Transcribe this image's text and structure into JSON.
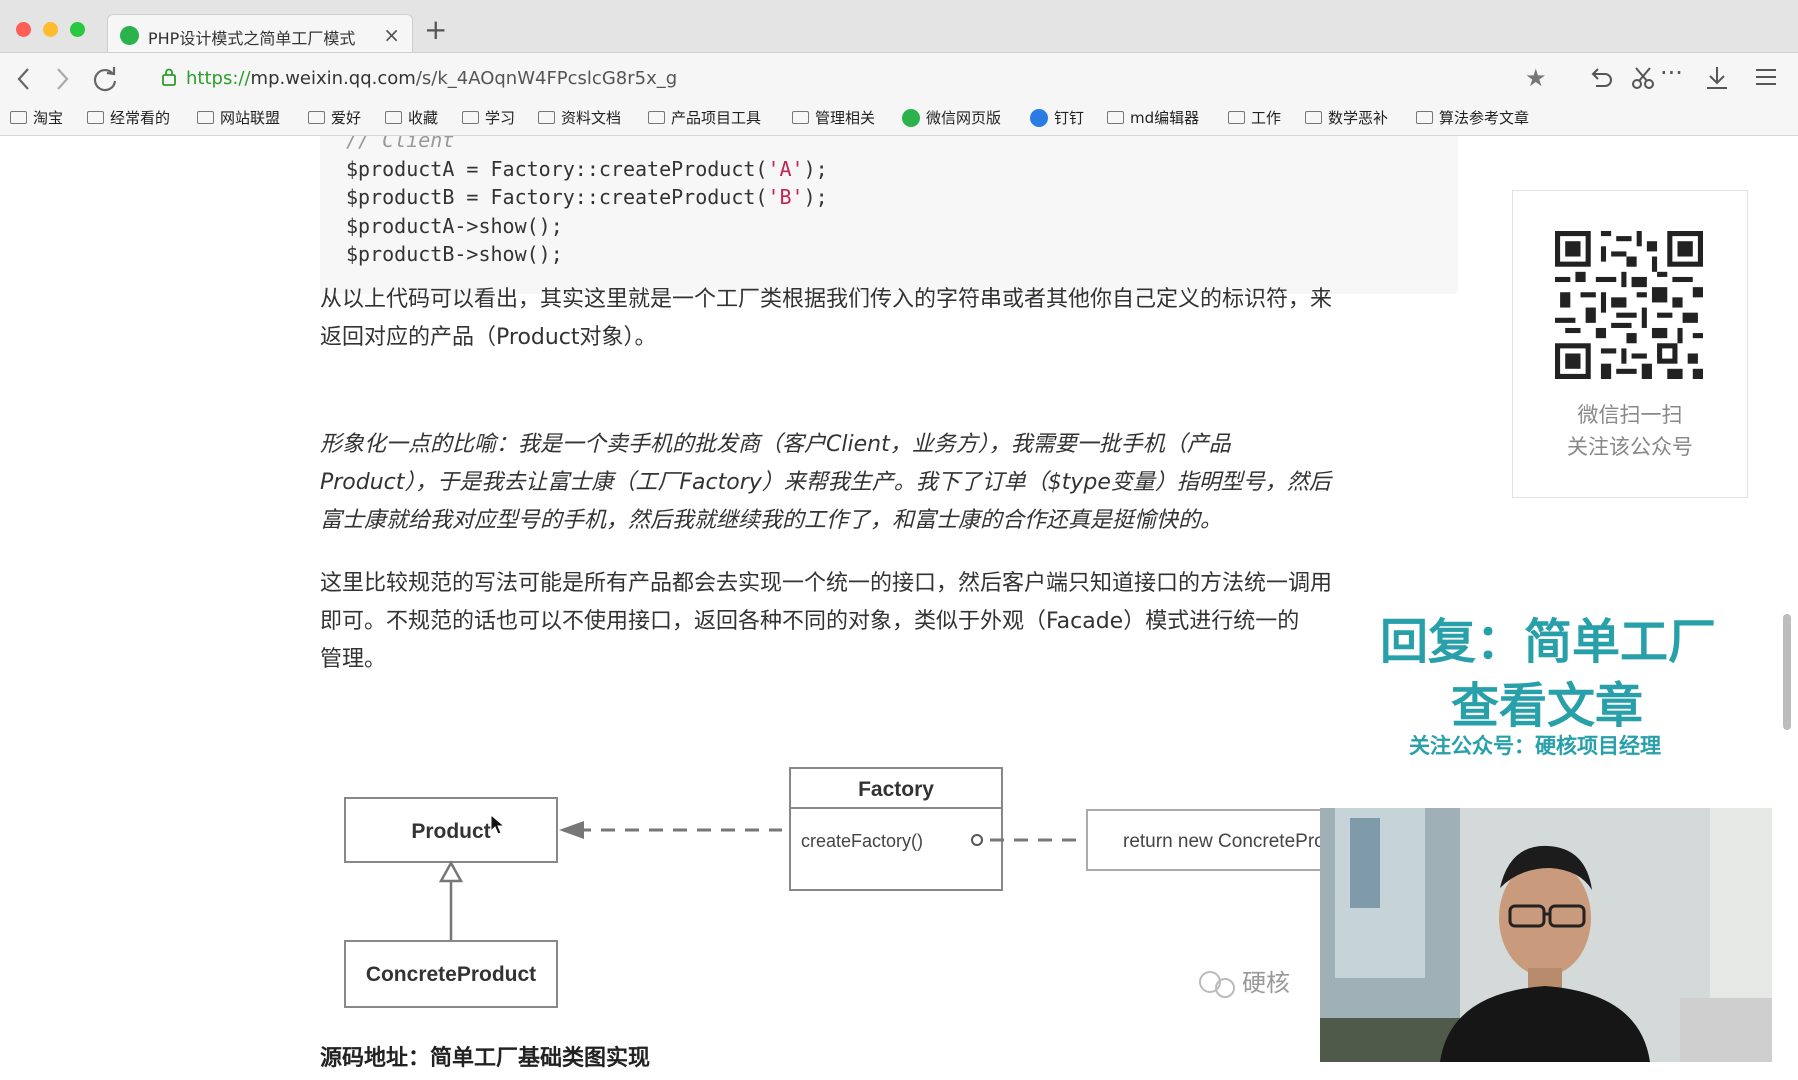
{
  "tab": {
    "title": "PHP设计模式之简单工厂模式",
    "close": "×",
    "new_tab": "+"
  },
  "address": {
    "scheme": "https://",
    "host": "mp.weixin.qq.com",
    "path": "/s/k_4AOqnW4FPcslcG8r5x_g"
  },
  "bookmarks": [
    "淘宝",
    "经常看的",
    "网站联盟",
    "爱好",
    "收藏",
    "学习",
    "资料文档",
    "产品项目工具",
    "管理相关",
    "微信网页版",
    "钉钉",
    "md编辑器",
    "工作",
    "数学恶补",
    "算法参考文章"
  ],
  "code": {
    "comment": "// Client",
    "line1_a": "$productA = Factory::createProduct(",
    "line1_str": "'A'",
    "line1_b": ");",
    "line2_a": "$productB = Factory::createProduct(",
    "line2_str": "'B'",
    "line2_b": ");",
    "line3": "$productA->show();",
    "line4": "$productB->show();"
  },
  "article": {
    "p1_line1": "从以上代码可以看出，其实这里就是一个工厂类根据我们传入的字符串或者其他你自己定义的标识符，来",
    "p1_line2": "返回对应的产品（Product对象）。",
    "p2_line1": "形象化一点的比喻：我是一个卖手机的批发商（客户Client，业务方），我需要一批手机（产品",
    "p2_line2": "Product），于是我去让富士康（工厂Factory）来帮我生产。我下了订单（$type变量）指明型号，然后",
    "p2_line3": "富士康就给我对应型号的手机，然后我就继续我的工作了，和富士康的合作还真是挺愉快的。",
    "p3_line1": "这里比较规范的写法可能是所有产品都会去实现一个统一的接口，然后客户端只知道接口的方法统一调用",
    "p3_line2": "即可。不规范的话也可以不使用接口，返回各种不同的对象，类似于外观（Facade）模式进行统一的",
    "p3_line3": "管理。",
    "source": "源码地址：简单工厂基础类图实现"
  },
  "diagram": {
    "product": "Product",
    "factory": "Factory",
    "factory_method": "createFactory()",
    "note": "return new ConcreteProduct",
    "concrete": "ConcreteProduct",
    "watermark": "硬核"
  },
  "qr": {
    "line1": "微信扫一扫",
    "line2": "关注该公众号"
  },
  "overlay": {
    "line1": "回复：简单工厂",
    "line2": "查看文章",
    "line3": "关注公众号：硬核项目经理"
  }
}
